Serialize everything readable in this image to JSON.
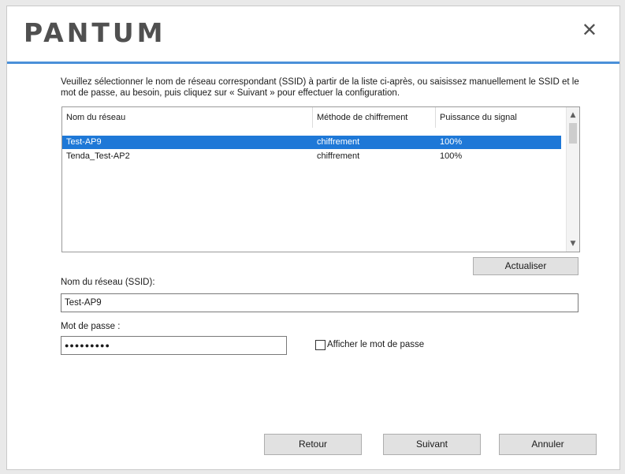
{
  "header": {
    "logo_text": "PANTUM",
    "close_glyph": "✕"
  },
  "instructions": "Veuillez sélectionner le nom de réseau correspondant (SSID) à partir de la liste ci-après, ou saisissez manuellement le SSID et le mot de passe, au besoin, puis cliquez sur « Suivant » pour effectuer la configuration.",
  "network_list": {
    "columns": [
      "Nom du réseau",
      "Méthode de chiffrement",
      "Puissance du signal"
    ],
    "rows": [
      {
        "ssid": "Test-AP9",
        "encryption": "chiffrement",
        "signal": "100%",
        "selected": true
      },
      {
        "ssid": "Tenda_Test-AP2",
        "encryption": "chiffrement",
        "signal": "100%",
        "selected": false
      }
    ]
  },
  "refresh_button": "Actualiser",
  "ssid_field": {
    "label": "Nom du réseau (SSID):",
    "value": "Test-AP9"
  },
  "password_field": {
    "label": "Mot de passe :",
    "value": "●●●●●●●●●"
  },
  "show_password": {
    "label": "Afficher le mot de passe",
    "checked": false
  },
  "footer": {
    "back": "Retour",
    "next": "Suivant",
    "cancel": "Annuler"
  },
  "colors": {
    "accent": "#4a90d9",
    "selection": "#1e78d7"
  }
}
